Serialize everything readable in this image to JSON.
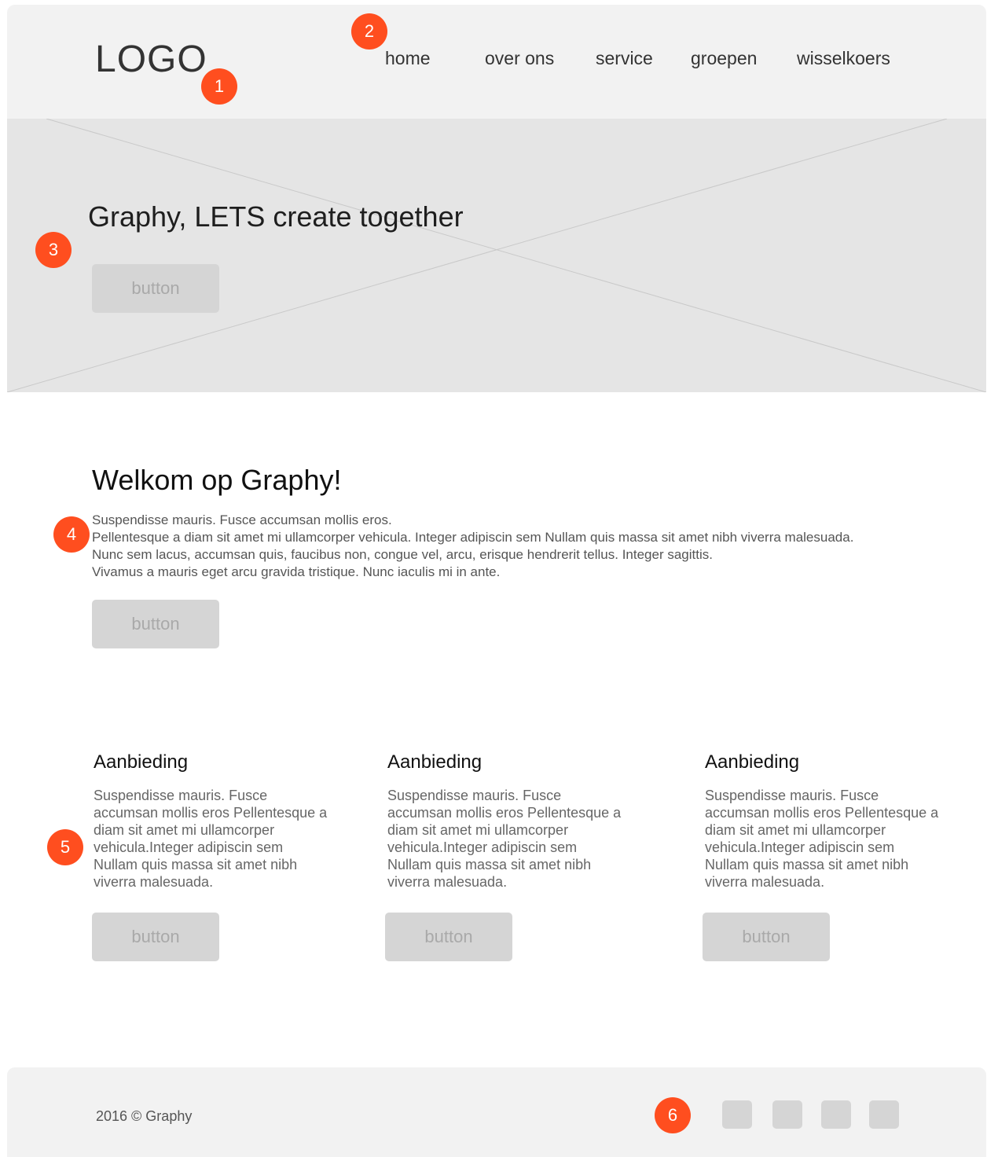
{
  "header": {
    "logo": "LOGO",
    "nav": [
      "home",
      "over ons",
      "service",
      "groepen",
      "wisselkoers"
    ]
  },
  "hero": {
    "title": "Graphy, LETS create together",
    "button": "button"
  },
  "welcome": {
    "title": "Welkom op Graphy!",
    "lines": [
      "Suspendisse mauris. Fusce accumsan mollis eros.",
      "Pellentesque a diam sit amet mi ullamcorper vehicula. Integer adipiscin sem Nullam quis massa sit amet nibh viverra malesuada.",
      "Nunc sem lacus, accumsan quis, faucibus non, congue vel, arcu, erisque hendrerit tellus. Integer sagittis.",
      "Vivamus a mauris eget arcu gravida tristique. Nunc iaculis mi in ante."
    ],
    "button": "button"
  },
  "cards": [
    {
      "title": "Aanbieding",
      "text": "Suspendisse mauris. Fusce accumsan mollis eros Pellentesque a diam sit amet mi ullamcorper vehicula.Integer adipiscin sem Nullam quis massa sit amet nibh viverra malesuada.",
      "button": "button"
    },
    {
      "title": "Aanbieding",
      "text": "Suspendisse mauris. Fusce accumsan mollis eros Pellentesque a diam sit amet mi ullamcorper vehicula.Integer adipiscin sem Nullam quis massa sit amet nibh viverra malesuada.",
      "button": "button"
    },
    {
      "title": "Aanbieding",
      "text": "Suspendisse mauris. Fusce accumsan mollis eros Pellentesque a diam sit amet mi ullamcorper vehicula.Integer adipiscin sem Nullam quis massa sit amet nibh viverra malesuada.",
      "button": "button"
    }
  ],
  "footer": {
    "copyright": "2016 © Graphy",
    "social_icons": [
      "social-icon",
      "social-icon",
      "social-icon",
      "social-icon"
    ]
  },
  "markers": [
    "1",
    "2",
    "3",
    "4",
    "5",
    "6"
  ],
  "colors": {
    "marker": "#ff4e1f",
    "panel": "#f2f2f2",
    "hero": "#e5e5e5",
    "button": "#d5d5d5",
    "button_text": "#a9a9a9"
  }
}
